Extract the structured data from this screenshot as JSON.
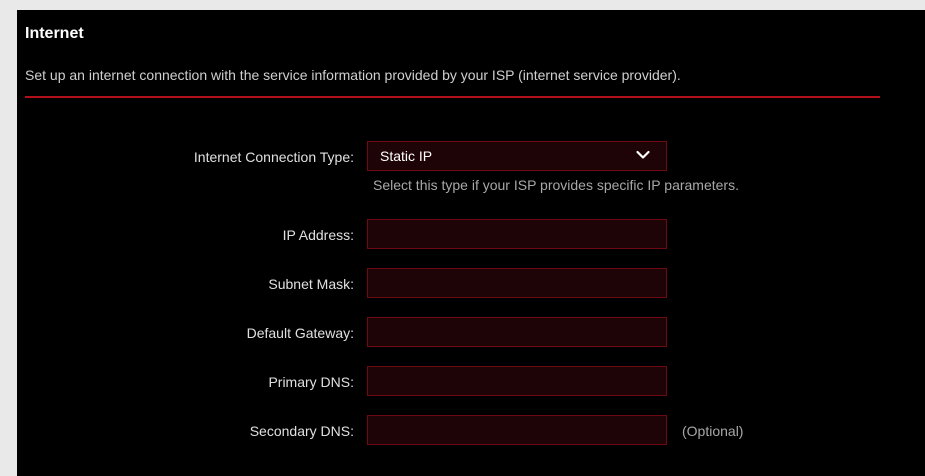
{
  "section": {
    "title": "Internet",
    "description": "Set up an internet connection with the service information provided by your ISP (internet service provider)."
  },
  "connection_type": {
    "label": "Internet Connection Type:",
    "selected": "Static IP",
    "hint": "Select this type if your ISP provides specific IP parameters."
  },
  "fields": {
    "ip_address": {
      "label": "IP Address:",
      "value": ""
    },
    "subnet_mask": {
      "label": "Subnet Mask:",
      "value": ""
    },
    "default_gateway": {
      "label": "Default Gateway:",
      "value": ""
    },
    "primary_dns": {
      "label": "Primary DNS:",
      "value": ""
    },
    "secondary_dns": {
      "label": "Secondary DNS:",
      "value": "",
      "note": "(Optional)"
    }
  },
  "icons": {
    "dropdown": "chevron-down-icon"
  },
  "colors": {
    "background": "#000000",
    "accent": "#b0101a",
    "field_border": "#6e0b12",
    "field_fill": "#1e0406"
  }
}
